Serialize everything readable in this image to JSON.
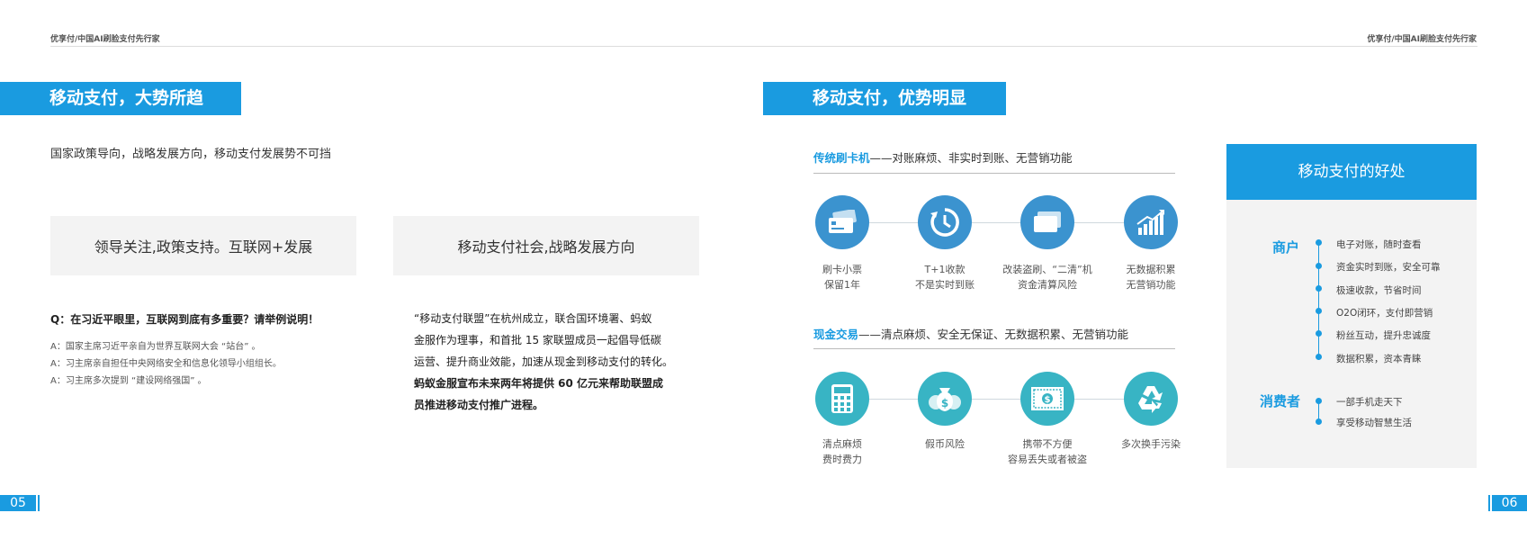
{
  "header": {
    "left_text": "优享付/中国AI刷脸支付先行家",
    "right_text": "优享付/中国AI刷脸支付先行家"
  },
  "left": {
    "section_title": "移动支付，大势所趋",
    "intro": "国家政策导向，战略发展方向，移动支付发展势不可挡",
    "box1": "领导关注,政策支持。互联网+发展",
    "box2": "移动支付社会,战略发展方向",
    "question": "Q：在习近平眼里，互联网到底有多重要？请举例说明！",
    "answers": [
      "A：国家主席习近平亲自为世界互联网大会 “站台” 。",
      "A：习主席亲自担任中央网络安全和信息化领导小组组长。",
      "A：习主席多次提到 “建设网络强国” 。"
    ],
    "para_lines": [
      "“移动支付联盟”在杭州成立，联合国环境署、蚂蚁",
      "金服作为理事，和首批 15 家联盟成员一起倡导低碳",
      "运营、提升商业效能，加速从现金到移动支付的转化。"
    ],
    "para_bold_lines": [
      "蚂蚁金服宣布未来两年将提供 60 亿元来帮助联盟成",
      "员推进移动支付推广进程。"
    ],
    "page_number": "05"
  },
  "right": {
    "section_title": "移动支付，优势明显",
    "pos_head_accent": "传统刷卡机",
    "pos_head_rest": "——对账麻烦、非实时到账、无营销功能",
    "pos_items": [
      {
        "icon": "receipt-card-icon",
        "line1": "刷卡小票",
        "line2": "保留1年"
      },
      {
        "icon": "clock-icon",
        "line1": "T+1收款",
        "line2": "不是实时到账"
      },
      {
        "icon": "cards-icon",
        "line1": "改装盗刷、“二清”机",
        "line2": "资金清算风险"
      },
      {
        "icon": "bar-chart-icon",
        "line1": "无数据积累",
        "line2": "无营销功能"
      }
    ],
    "cash_head_accent": "现金交易",
    "cash_head_rest": "——清点麻烦、安全无保证、无数据积累、无营销功能",
    "cash_items": [
      {
        "icon": "calculator-icon",
        "line1": "清点麻烦",
        "line2": "费时费力"
      },
      {
        "icon": "money-bag-icon",
        "line1": "假币风险",
        "line2": ""
      },
      {
        "icon": "banknote-icon",
        "line1": "携带不方便",
        "line2": "容易丢失或者被盗"
      },
      {
        "icon": "recycle-icon",
        "line1": "多次换手污染",
        "line2": ""
      }
    ],
    "benefits": {
      "title": "移动支付的好处",
      "merchant_label": "商户",
      "merchant_items": [
        "电子对账，随时查看",
        "资金实时到账，安全可靠",
        "极速收款，节省时间",
        "O2O闭环，支付即营销",
        "粉丝互动，提升忠诚度",
        "数据积累，资本青睐"
      ],
      "consumer_label": "消费者",
      "consumer_items": [
        "一部手机走天下",
        "享受移动智慧生活"
      ]
    },
    "page_number": "06"
  },
  "colors": {
    "accent": "#1a9be0",
    "icon_blue": "#3b93cf",
    "icon_teal": "#38b4c4",
    "box_gray": "#f3f3f3"
  }
}
